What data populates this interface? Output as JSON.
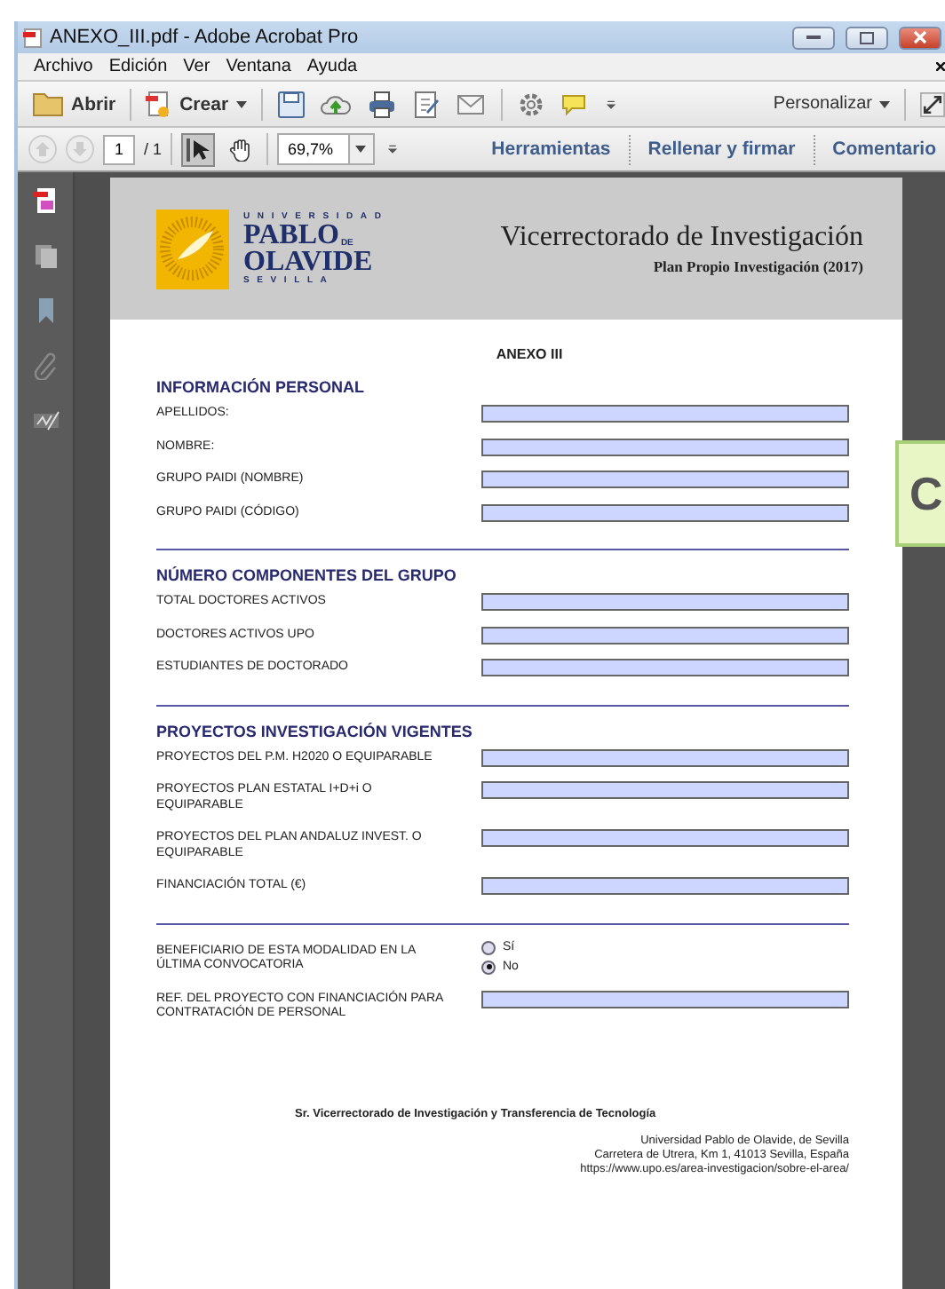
{
  "window": {
    "title": "ANEXO_III.pdf - Adobe Acrobat Pro"
  },
  "menu": [
    "Archivo",
    "Edición",
    "Ver",
    "Ventana",
    "Ayuda"
  ],
  "toolbar": {
    "open": "Abrir",
    "create": "Crear",
    "customize": "Personalizar"
  },
  "nav": {
    "page": "1",
    "pages": "/ 1",
    "zoom": "69,7%",
    "tools": [
      {
        "kind": "select",
        "selected": true
      },
      {
        "kind": "hand",
        "selected": false
      }
    ],
    "panels": [
      "Herramientas",
      "Rellenar y firmar",
      "Comentario"
    ]
  },
  "document": {
    "logo": {
      "top": "UNIVERSIDAD",
      "name1": "PABLO",
      "de": "DE",
      "name2": "OLAVIDE",
      "bottom": "SEVILLA"
    },
    "title": "Vicerrectorado de Investigación",
    "subtitle": "Plan Propio Investigación (2017)",
    "annex": "ANEXO III",
    "sections": [
      {
        "title": "INFORMACIÓN PERSONAL",
        "fields": [
          {
            "kind": "text",
            "label": "APELLIDOS:"
          },
          {
            "kind": "text",
            "label": "NOMBRE:"
          },
          {
            "kind": "text",
            "label": "GRUPO PAIDI (NOMBRE)"
          },
          {
            "kind": "text",
            "label": "GRUPO PAIDI (CÓDIGO)"
          }
        ]
      },
      {
        "title": "NÚMERO COMPONENTES DEL GRUPO",
        "fields": [
          {
            "kind": "text",
            "label": "TOTAL DOCTORES ACTIVOS"
          },
          {
            "kind": "text",
            "label": "DOCTORES ACTIVOS UPO"
          },
          {
            "kind": "text",
            "label": "ESTUDIANTES DE DOCTORADO"
          }
        ]
      },
      {
        "title": "PROYECTOS INVESTIGACIÓN VIGENTES",
        "fields": [
          {
            "kind": "text",
            "label": "PROYECTOS DEL P.M. H2020 O EQUIPARABLE"
          },
          {
            "kind": "text",
            "label": "PROYECTOS PLAN ESTATAL I+D+i O EQUIPARABLE"
          },
          {
            "kind": "text",
            "label": "PROYECTOS DEL PLAN ANDALUZ INVEST. O EQUIPARABLE"
          },
          {
            "kind": "text",
            "label": "FINANCIACIÓN TOTAL (€)"
          }
        ]
      },
      {
        "fields": [
          {
            "kind": "radio",
            "label": "BENEFICIARIO DE ESTA MODALIDAD EN LA ÚLTIMA CONVOCATORIA",
            "options": [
              {
                "label": "Sí",
                "selected": false
              },
              {
                "label": "No",
                "selected": true
              }
            ]
          },
          {
            "kind": "text",
            "label": "REF. DEL PROYECTO CON FINANCIACIÓN PARA CONTRATACIÓN DE PERSONAL"
          }
        ]
      }
    ],
    "signatory": "Sr. Vicerrectorado de Investigación y Transferencia de Tecnología",
    "address": [
      "Universidad Pablo de Olavide, de Sevilla",
      "Carretera de Utrera, Km 1, 41013 Sevilla, España",
      "https://www.upo.es/area-investigacion/sobre-el-area/"
    ]
  },
  "callout": {
    "text": "C"
  }
}
